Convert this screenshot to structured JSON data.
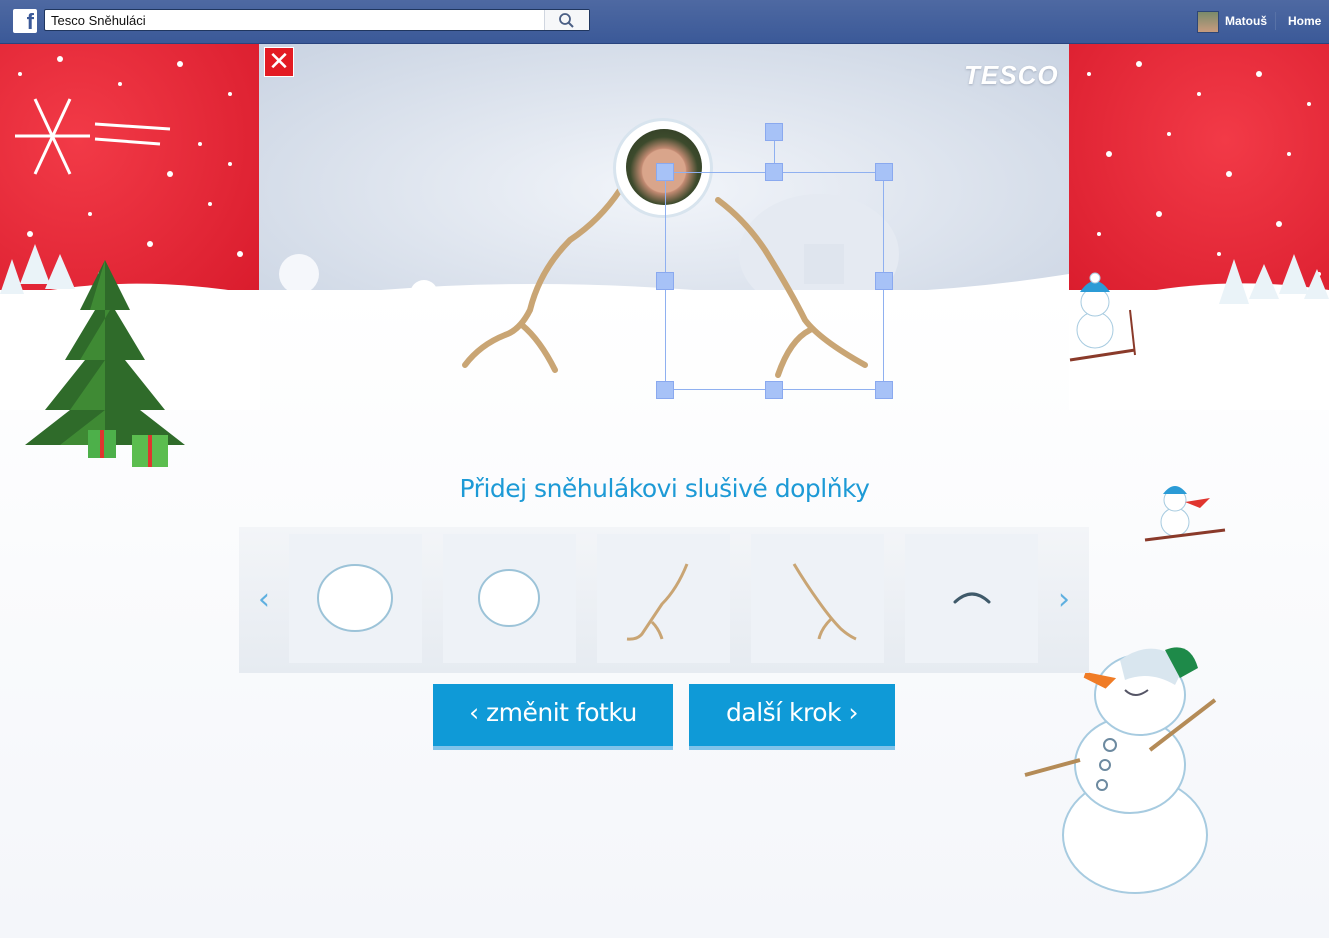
{
  "topbar": {
    "logo_letter": "f",
    "search": {
      "value": "Tesco Sněhuláci",
      "placeholder": ""
    },
    "user_name": "Matouš",
    "home_label": "Home"
  },
  "app": {
    "close_label": "✕",
    "brand": "TESCO",
    "heading": "Přidej sněhulákovi slušivé doplňky",
    "carousel": {
      "prev_label": "‹",
      "next_label": "›",
      "items": [
        "large snowball",
        "small snowball",
        "left branch arm",
        "right branch arm",
        "mouth curve"
      ]
    },
    "buttons": {
      "change_photo": "‹ změnit fotku",
      "next_step": "další krok ›"
    }
  },
  "colors": {
    "facebook_blue": "#3b5998",
    "tesco_red": "#e31b23",
    "accent_blue": "#0f9ad7",
    "heading_blue": "#1d9ad6",
    "branch_brown": "#c9a574"
  }
}
